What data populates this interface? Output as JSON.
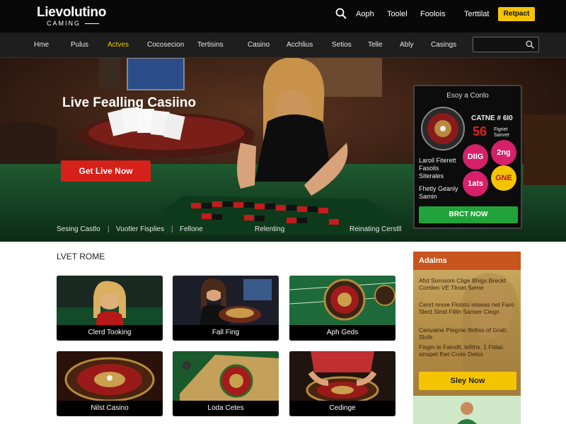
{
  "logo": {
    "name": "Lievolutino",
    "sub": "CAMING"
  },
  "top_links": [
    "Aoph",
    "Toolel",
    "Foolois",
    "Terttilat"
  ],
  "register_label": "Retpact",
  "nav": [
    {
      "label": "Hme",
      "active": false
    },
    {
      "label": "Pulus",
      "active": false
    },
    {
      "label": "Actves",
      "active": true
    },
    {
      "label": "Cocosecion",
      "active": false
    },
    {
      "label": "Tertisins",
      "active": false
    },
    {
      "label": "Casino",
      "active": false
    },
    {
      "label": "Acchlius",
      "active": false
    },
    {
      "label": "Setios",
      "active": false
    },
    {
      "label": "Telle",
      "active": false
    },
    {
      "label": "Ably",
      "active": false
    },
    {
      "label": "Casings",
      "active": false
    }
  ],
  "hero": {
    "title": "Live Fealling Casiino",
    "cta": "Get Live Now",
    "bottom_links": [
      "Sesing Castlo",
      "Vuotler Fisplies",
      "Fellone",
      "Relenting",
      "Reinating Cerstll"
    ]
  },
  "promo": {
    "title": "Esoy a Conlo",
    "headline": "CATNE # 6I0",
    "number": "56",
    "side_note": "Figriet Sanvet",
    "text1": "Laroll Fiterett Fasolis Siterales",
    "text2": "Fhetly Geanly Samin",
    "bubbles": [
      "DIIG",
      "2ng",
      "1ats",
      "GNE"
    ],
    "button": "BRCT NOW"
  },
  "section_title": "LVET ROME",
  "tiles": [
    "Clerd Tooking",
    "Fall Fing",
    "Aph Geds",
    "Nilst Casino",
    "Loda Cetes",
    "Cedinge"
  ],
  "sidebar": {
    "title": "Adalms",
    "paragraphs": [
      "Afst Sornsom Clige Bhigs Breckt Comlen VE Tlroet Seme",
      "Cenrt nrsve Flotsto istseas net Faro Slect Sinst Fillin Sanser Ciegn",
      "Cenvaine Plegnie tfelliss of Gratt. Slofe",
      "Fisgin le Faindlt, lefiths. 1 Fldas sinspet fhet Crate Delos"
    ],
    "button": "Sley Now"
  },
  "colors": {
    "accent": "#f5c400",
    "cta": "#d6201a",
    "promo_button": "#22a33a",
    "sidebar_header": "#c8541e"
  }
}
